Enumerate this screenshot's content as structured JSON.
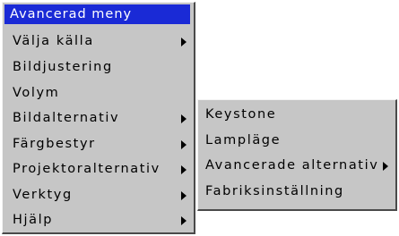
{
  "main_menu": {
    "title": "Avancerad meny",
    "items": [
      {
        "label": "Välja källa",
        "has_submenu": true
      },
      {
        "label": "Bildjustering",
        "has_submenu": false
      },
      {
        "label": "Volym",
        "has_submenu": false
      },
      {
        "label": "Bildalternativ",
        "has_submenu": true
      },
      {
        "label": "Färgbestyr",
        "has_submenu": true
      },
      {
        "label": "Projektoralternativ",
        "has_submenu": true
      },
      {
        "label": "Verktyg",
        "has_submenu": true
      },
      {
        "label": "Hjälp",
        "has_submenu": true
      }
    ]
  },
  "sub_menu": {
    "items": [
      {
        "label": "Keystone",
        "has_submenu": false
      },
      {
        "label": "Lampläge",
        "has_submenu": false
      },
      {
        "label": "Avancerade alternativ",
        "has_submenu": true
      },
      {
        "label": "Fabriksinställning",
        "has_submenu": false
      }
    ]
  },
  "colors": {
    "menu_background": "#c6c6c6",
    "title_highlight": "#1a2ad6",
    "title_text": "#ffffff",
    "item_text": "#000000"
  },
  "icons": {
    "submenu_indicator": "caret-right-icon"
  }
}
